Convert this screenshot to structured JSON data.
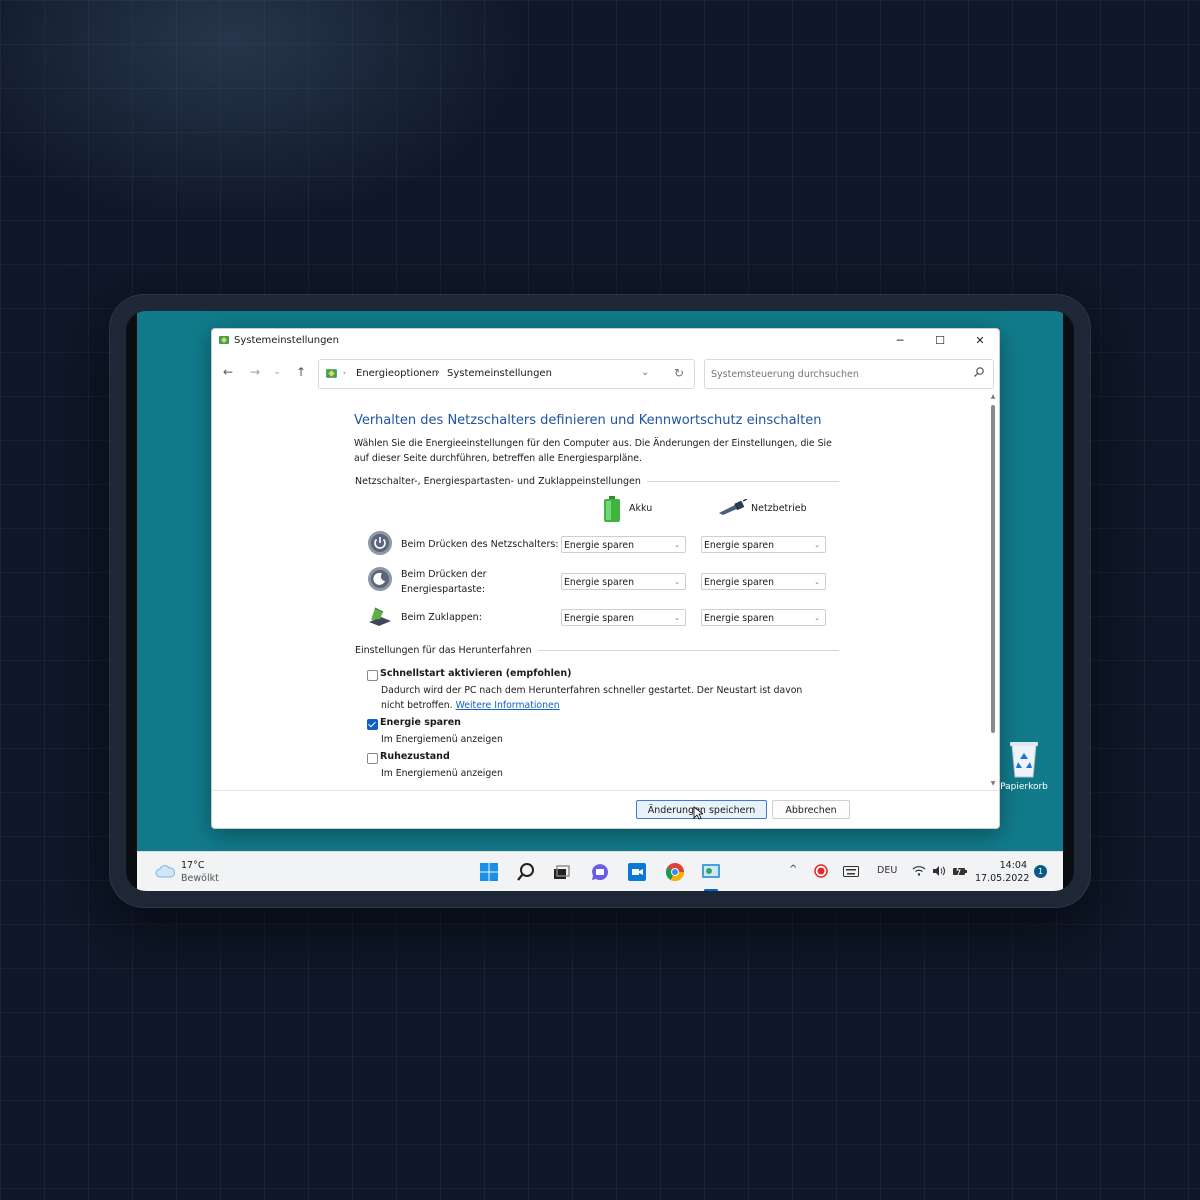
{
  "window": {
    "title": "Systemeinstellungen",
    "minimize": "─",
    "maximize": "☐",
    "close": "✕"
  },
  "nav": {
    "back": "←",
    "forward": "→",
    "recent": "⌄",
    "up": "↑",
    "breadcrumb": [
      "Energieoptionen",
      "Systemeinstellungen"
    ],
    "crumb_prefix": "›",
    "crumb_separator": "›",
    "dropdown": "⌄",
    "refresh": "↻"
  },
  "search": {
    "placeholder": "Systemsteuerung durchsuchen"
  },
  "main": {
    "heading": "Verhalten des Netzschalters definieren und Kennwortschutz einschalten",
    "description": "Wählen Sie die Energieeinstellungen für den Computer aus. Die Änderungen der Einstellungen, die Sie auf dieser Seite durchführen, betreffen alle Energiesparpläne.",
    "power_group": "Netzschalter-, Energiespartasten- und Zuklappeinstellungen",
    "columns": [
      "Akku",
      "Netzbetrieb"
    ],
    "rows": [
      {
        "label": "Beim Drücken des Netzschalters:",
        "battery": "Energie sparen",
        "ac": "Energie sparen"
      },
      {
        "label": "Beim Drücken der Energiespartaste:",
        "battery": "Energie sparen",
        "ac": "Energie sparen"
      },
      {
        "label": "Beim Zuklappen:",
        "battery": "Energie sparen",
        "ac": "Energie sparen"
      }
    ],
    "shutdown_group": "Einstellungen für das Herunterfahren",
    "options": [
      {
        "title": "Schnellstart aktivieren (empfohlen)",
        "desc": "Dadurch wird der PC nach dem Herunterfahren schneller gestartet. Der Neustart ist davon nicht betroffen.",
        "link": "Weitere Informationen",
        "checked": false
      },
      {
        "title": "Energie sparen",
        "desc": "Im Energiemenü anzeigen",
        "checked": true
      },
      {
        "title": "Ruhezustand",
        "desc": "Im Energiemenü anzeigen",
        "checked": false
      }
    ]
  },
  "footer": {
    "save": "Änderungen speichern",
    "cancel": "Abbrechen"
  },
  "desktop": {
    "recycle_bin": "Papierkorb"
  },
  "taskbar": {
    "temperature": "17°C",
    "condition": "Bewölkt",
    "language": "DEU",
    "time": "14:04",
    "date": "17.05.2022",
    "notifications": "1",
    "tray_chevron": "^",
    "icons": [
      "windows-start-icon",
      "search-icon",
      "task-view-icon",
      "teams-chat-icon",
      "meet-icon",
      "chrome-icon",
      "control-panel-icon"
    ]
  },
  "colors": {
    "desktop": "#117b8b",
    "heading": "#1d55a0",
    "accent": "#0c5fc4",
    "link": "#1060c8",
    "record": "#e02a2a"
  }
}
